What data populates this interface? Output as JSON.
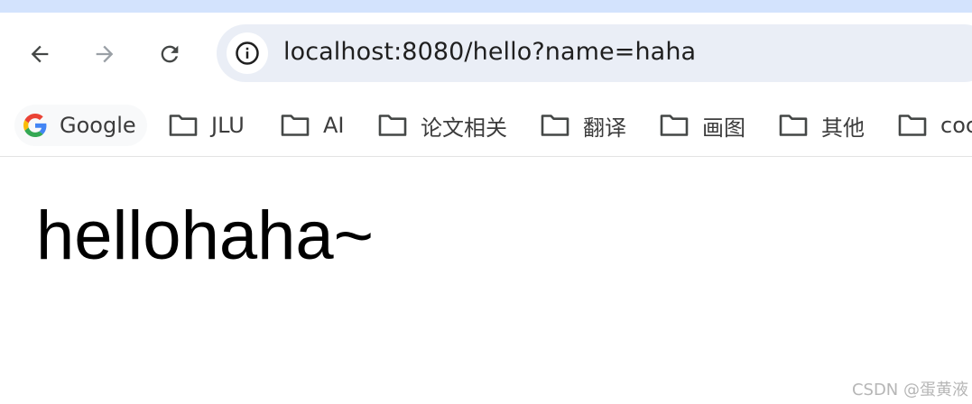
{
  "browser": {
    "accent_color": "#d3e3fd",
    "toolbar": {
      "back_icon": "arrow-left-icon",
      "forward_icon": "arrow-right-icon",
      "reload_icon": "reload-icon",
      "site_info_icon": "info-circle-icon"
    },
    "address_bar": {
      "url": "localhost:8080/hello?name=haha"
    },
    "bookmarks": [
      {
        "label": "Google",
        "icon": "google-g-icon"
      },
      {
        "label": "JLU",
        "icon": "folder-icon"
      },
      {
        "label": "AI",
        "icon": "folder-icon"
      },
      {
        "label": "论文相关",
        "icon": "folder-icon"
      },
      {
        "label": "翻译",
        "icon": "folder-icon"
      },
      {
        "label": "画图",
        "icon": "folder-icon"
      },
      {
        "label": "其他",
        "icon": "folder-icon"
      },
      {
        "label": "coc",
        "icon": "folder-icon"
      }
    ]
  },
  "page": {
    "text": "hellohaha~"
  },
  "watermark": {
    "text": "CSDN @蛋黄液"
  }
}
